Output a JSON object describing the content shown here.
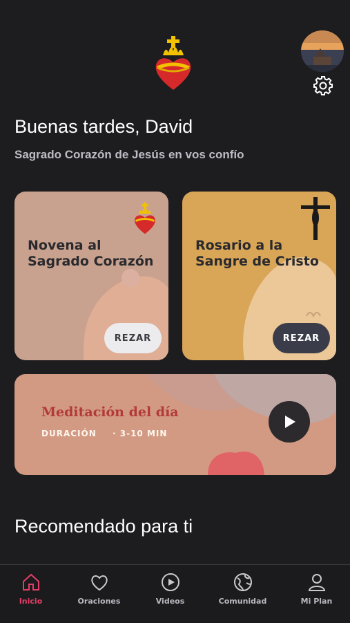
{
  "header": {
    "greeting": "Buenas tardes, David",
    "subtitle": "Sagrado Corazón de Jesús en vos confío"
  },
  "cards": [
    {
      "title": "Novena al Sagrado Corazón",
      "button": "REZAR"
    },
    {
      "title": "Rosario a la Sangre de Cristo",
      "button": "REZAR"
    }
  ],
  "meditation": {
    "title": "Meditación del día",
    "duration_label": "DURACIÓN",
    "duration_value": "· 3-10 MIN"
  },
  "recommended": {
    "title": "Recomendado para ti"
  },
  "nav": [
    {
      "label": "Inicio",
      "icon": "home-icon",
      "active": true
    },
    {
      "label": "Oraciones",
      "icon": "heart-icon"
    },
    {
      "label": "Videos",
      "icon": "play-circle-icon"
    },
    {
      "label": "Comunidad",
      "icon": "globe-icon"
    },
    {
      "label": "Mi Plan",
      "icon": "user-icon"
    }
  ],
  "colors": {
    "background": "#1d1d1f",
    "accent": "#e63d66",
    "novena_card": "#c9a28f",
    "rosario_card": "#d9a657",
    "meditation_card": "#d39a83"
  }
}
